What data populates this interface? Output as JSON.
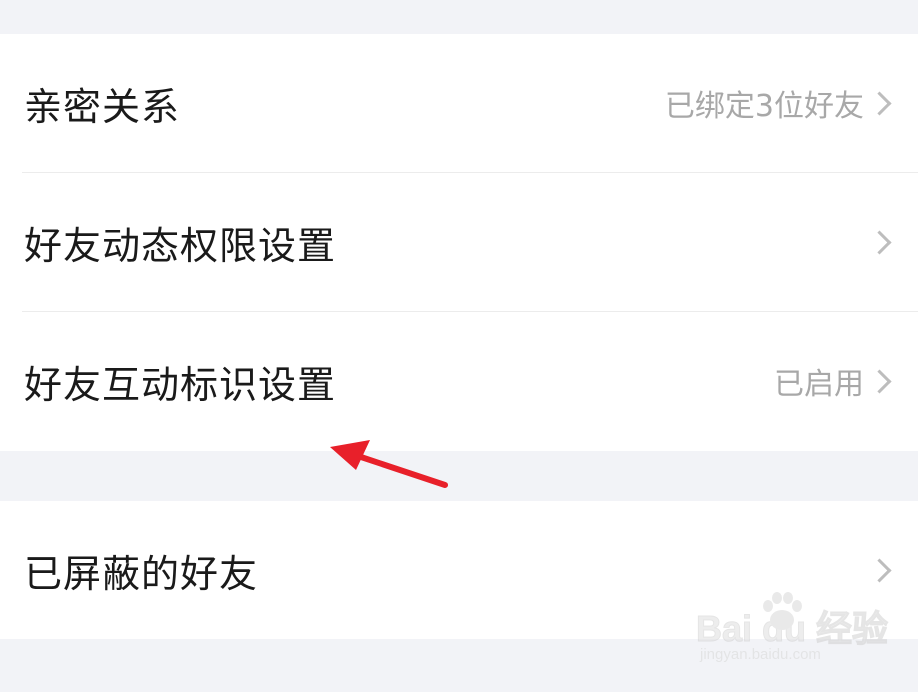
{
  "settings": {
    "rows": [
      {
        "label": "亲密关系",
        "value": "已绑定3位好友"
      },
      {
        "label": "好友动态权限设置",
        "value": ""
      },
      {
        "label": "好友互动标识设置",
        "value": "已启用"
      },
      {
        "label": "已屏蔽的好友",
        "value": ""
      }
    ]
  },
  "annotation": {
    "arrow_color": "#e8202a"
  },
  "watermark": {
    "brand": "Bai du 经验",
    "domain": "jingyan.baidu.com"
  }
}
